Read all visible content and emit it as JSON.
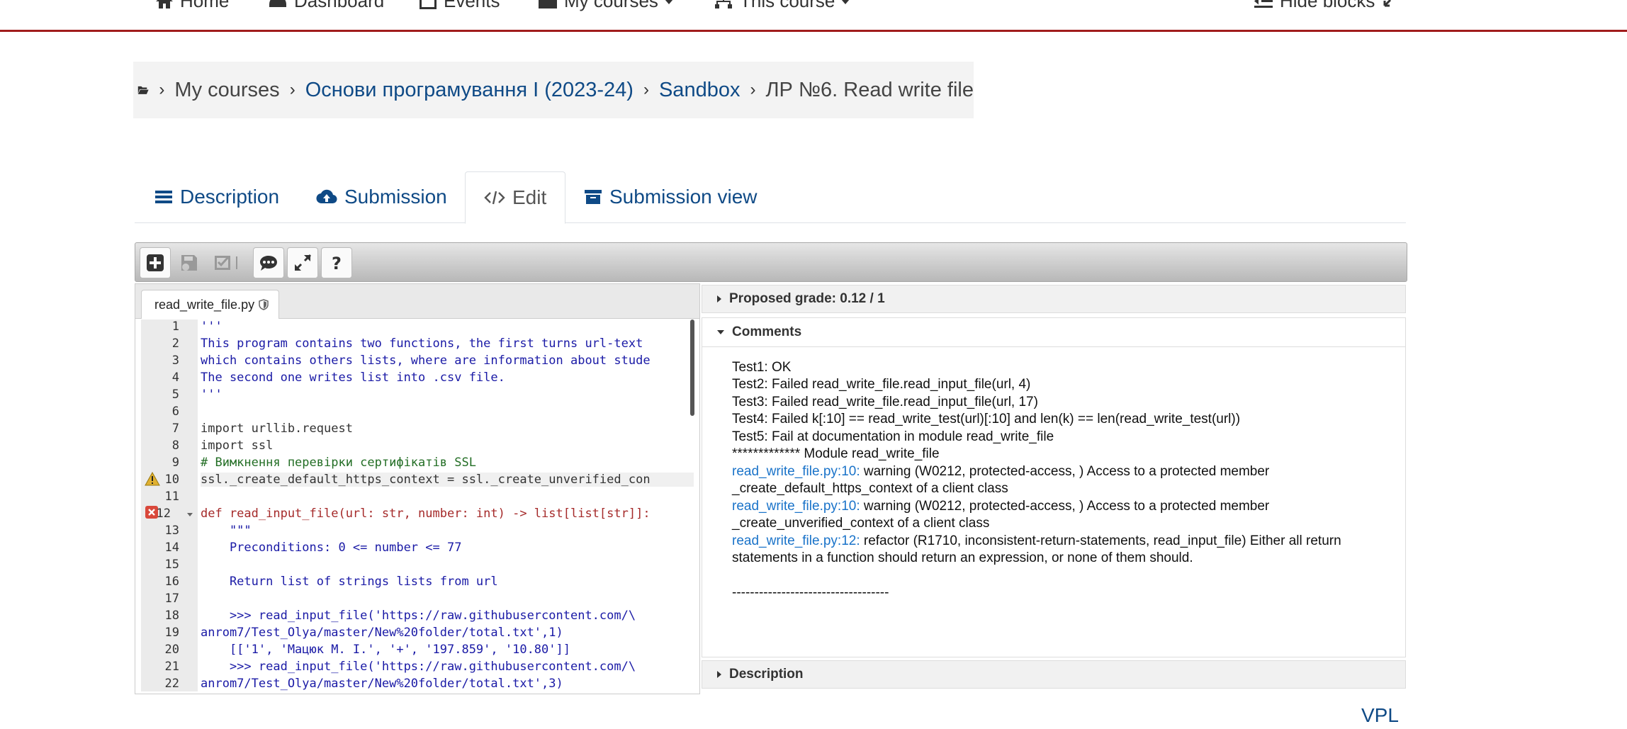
{
  "nav": {
    "home": "Home",
    "dashboard": "Dashboard",
    "events": "Events",
    "my_courses": "My courses",
    "this_course": "This course",
    "hide_blocks": "Hide blocks"
  },
  "breadcrumb": {
    "items": [
      "My courses",
      "Основи програмування I (2023-24)",
      "Sandbox",
      "ЛР №6. Read write file"
    ]
  },
  "tabs": [
    "Description",
    "Submission",
    "Edit",
    "Submission view"
  ],
  "editor": {
    "file_name": "read_write_file.py",
    "line_numbers": [
      "1",
      "2",
      "3",
      "4",
      "5",
      "6",
      "7",
      "8",
      "9",
      "10",
      "11",
      "12",
      "13",
      "14",
      "15",
      "16",
      "17",
      "18",
      "19",
      "20",
      "21",
      "22"
    ],
    "lines": [
      "'''",
      "This program contains two functions, the first turns url-text",
      "which contains others lists, where are information about stude",
      "The second one writes list into .csv file.",
      "'''",
      "",
      "import urllib.request",
      "import ssl",
      "# Вимкнення перевірки сертифікатів SSL",
      "ssl._create_default_https_context = ssl._create_unverified_con",
      "",
      "def read_input_file(url: str, number: int) -> list[list[str]]:",
      "    \"\"\"",
      "    Preconditions: 0 <= number <= 77",
      "",
      "    Return list of strings lists from url",
      "",
      "    >>> read_input_file('https://raw.githubusercontent.com/\\",
      "anrom7/Test_Olya/master/New%20folder/total.txt',1)",
      "    [['1', 'Мацюк М. І.', '+', '197.859', '10.80']]",
      "    >>> read_input_file('https://raw.githubusercontent.com/\\",
      "anrom7/Test_Olya/master/New%20folder/total.txt',3)"
    ]
  },
  "right_panel": {
    "proposed_grade": "Proposed grade: 0.12 / 1",
    "comments_title": "Comments",
    "description_title": "Description",
    "comments": {
      "t1": "Test1: OK",
      "t2": "Test2: Failed read_write_file.read_input_file(url, 4)",
      "t3": "Test3: Failed read_write_file.read_input_file(url, 17)",
      "t4": "Test4: Failed k[:10] == read_write_test(url)[:10] and len(k) == len(read_write_test(url))",
      "t5": "Test5: Fail at documentation in module read_write_file",
      "module": "************* Module read_write_file",
      "w1_link": "read_write_file.py:10:",
      "w1_text": " warning (W0212, protected-access, ) Access to a protected member",
      "w1_cont": "_create_default_https_context of a client class",
      "w2_link": "read_write_file.py:10:",
      "w2_text": " warning (W0212, protected-access, ) Access to a protected member",
      "w2_cont": "_create_unverified_context of a client class",
      "r1_link": "read_write_file.py:12:",
      "r1_text": " refactor (R1710, inconsistent-return-statements, read_input_file) Either all return",
      "r1_cont": "statements in a function should return an expression, or none of them should.",
      "separator": "-----------------------------------"
    }
  },
  "footer": {
    "vpl": "VPL"
  }
}
